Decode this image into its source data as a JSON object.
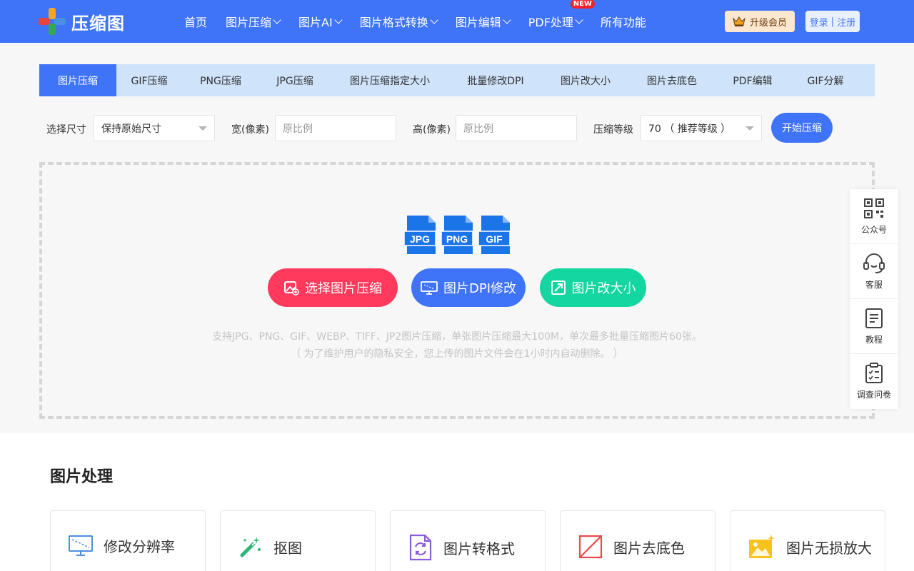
{
  "brand": {
    "name": "压缩图"
  },
  "nav": [
    {
      "label": "首页",
      "dropdown": false
    },
    {
      "label": "图片压缩",
      "dropdown": true
    },
    {
      "label": "图片AI",
      "dropdown": true
    },
    {
      "label": "图片格式转换",
      "dropdown": true
    },
    {
      "label": "图片编辑",
      "dropdown": true
    },
    {
      "label": "PDF处理",
      "dropdown": true,
      "badge": "NEW"
    },
    {
      "label": "所有功能",
      "dropdown": false
    }
  ],
  "header": {
    "vip_label": "升级会员",
    "login_label": "登录",
    "register_label": "注册",
    "separator": "|"
  },
  "tabs": [
    "图片压缩",
    "GIF压缩",
    "PNG压缩",
    "JPG压缩",
    "图片压缩指定大小",
    "批量修改DPI",
    "图片改大小",
    "图片去底色",
    "PDF编辑",
    "GIF分解"
  ],
  "options": {
    "size_label": "选择尺寸",
    "size_value": "保持原始尺寸",
    "width_label": "宽(像素)",
    "width_placeholder": "原比例",
    "height_label": "高(像素)",
    "height_placeholder": "原比例",
    "level_label": "压缩等级",
    "level_value": "70 （ 推荐等级 ）",
    "start_label": "开始压缩"
  },
  "upload": {
    "filetypes": [
      "JPG",
      "PNG",
      "GIF"
    ],
    "buttons": [
      {
        "label": "选择图片压缩",
        "color": "#ff3a5c"
      },
      {
        "label": "图片DPI修改",
        "color": "#3f73f8"
      },
      {
        "label": "图片改大小",
        "color": "#14d6a0"
      }
    ],
    "hint1": "支持JPG、PNG、GIF、WEBP、TIFF、JP2图片压缩，单张图片压缩最大100M，单次最多批量压缩图片60张。",
    "hint2": "（ 为了维护用户的隐私安全，您上传的图片文件会在1小时内自动删除。 ）"
  },
  "side": [
    "公众号",
    "客服",
    "教程",
    "调查问卷"
  ],
  "section": {
    "title": "图片处理",
    "cards": [
      "修改分辨率",
      "抠图",
      "图片转格式",
      "图片去底色",
      "图片无损放大"
    ]
  },
  "colors": {
    "primary": "#3f73f8",
    "tab_bg": "#cfe3fb",
    "accent_red": "#ff3a5c",
    "accent_green": "#14d6a0"
  }
}
